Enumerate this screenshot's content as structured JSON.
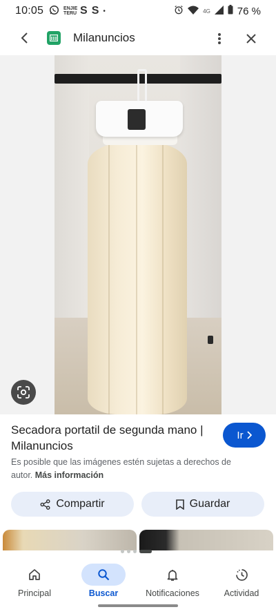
{
  "status_bar": {
    "time": "10:05",
    "s1": "S",
    "s2": "S",
    "dot": "•",
    "network": "4G",
    "battery": "76 %",
    "small_app_text": "ENJIE TERU"
  },
  "app_bar": {
    "site_name": "Milanuncios"
  },
  "result": {
    "title": "Secadora portatil de segunda mano | Milanuncios",
    "go_button": "Ir",
    "rights_text": "Es posible que las imágenes estén sujetas a derechos de autor.",
    "more_info": "Más información"
  },
  "actions": {
    "share": "Compartir",
    "save": "Guardar"
  },
  "bottom_nav": {
    "items": [
      {
        "label": "Principal",
        "icon": "home-icon"
      },
      {
        "label": "Buscar",
        "icon": "search-icon",
        "active": true
      },
      {
        "label": "Notificaciones",
        "icon": "bell-icon"
      },
      {
        "label": "Actividad",
        "icon": "activity-icon"
      }
    ]
  },
  "colors": {
    "accent": "#0b57d0",
    "button_bg": "#e8eef9",
    "favicon": "#21a366"
  }
}
